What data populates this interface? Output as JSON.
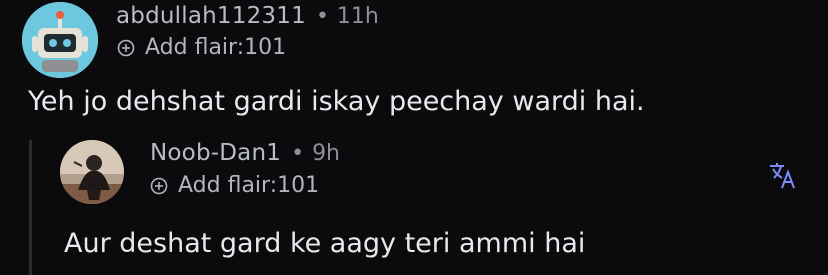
{
  "comments": [
    {
      "username": "abdullah112311",
      "separator": "•",
      "time": "11h",
      "flair": "Add flair:101",
      "body": "Yeh jo dehshat gardi iskay peechay wardi hai."
    },
    {
      "username": "Noob-Dan1",
      "separator": "•",
      "time": "9h",
      "flair": "Add flair:101",
      "body": "Aur deshat gard ke aagy teri ammi hai"
    }
  ],
  "icons": {
    "add_flair": "plus-circle-icon",
    "translate": "translate-icon"
  },
  "colors": {
    "background": "#0b0b0d",
    "text": "#e7e9ec",
    "meta": "#8c9097",
    "accent": "#7c8cff"
  }
}
